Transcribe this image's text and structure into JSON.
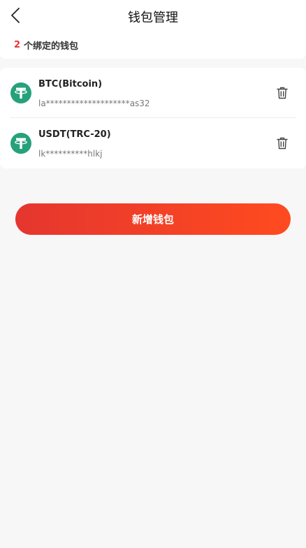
{
  "header": {
    "title": "钱包管理",
    "back_icon": "chevron-left-icon"
  },
  "summary": {
    "count": "2",
    "label": "个绑定的钱包"
  },
  "wallets": [
    {
      "name": "BTC(Bitcoin)",
      "address": "la********************as32",
      "icon": "tether-icon"
    },
    {
      "name": "USDT(TRC-20)",
      "address": "lk**********hlkj",
      "icon": "tether-icon"
    }
  ],
  "add_button": {
    "label": "新增钱包"
  },
  "colors": {
    "accent": "#e8333a",
    "tether": "#26a17b",
    "button_start": "#e5362f",
    "button_end": "#ff4b1f"
  }
}
